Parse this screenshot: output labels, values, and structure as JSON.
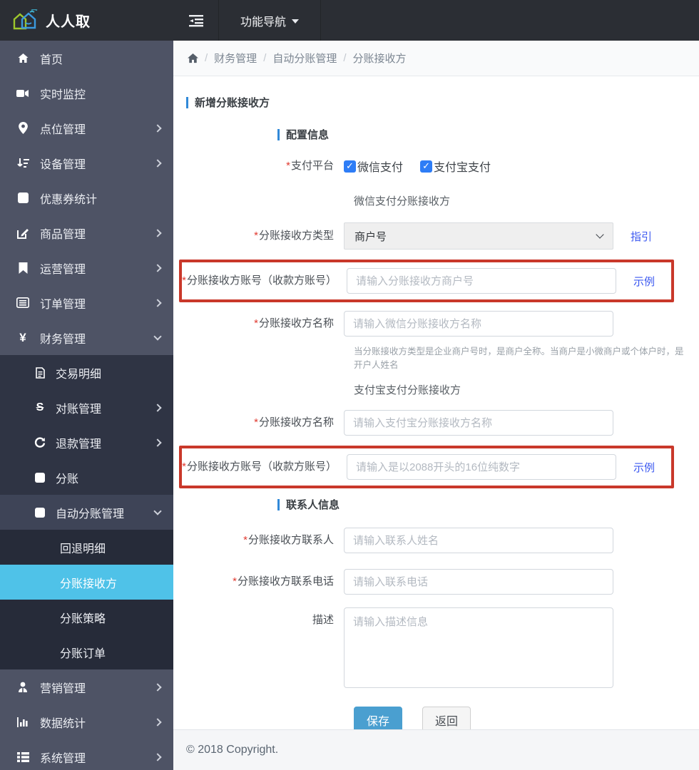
{
  "colors": {
    "c-header": "#2b2e34",
    "c-sidebar": "#4e5365",
    "c-sub1": "#2f3444",
    "c-sub1-open": "#3e4457",
    "c-sub2": "#262b39",
    "c-active": "#4fc2e8",
    "c-bar": "#3189d8",
    "c-link": "#3a57f0",
    "c-hl": "#c9382a",
    "c-primary": "#4a9fd0",
    "c-checkbox": "#2e7df6"
  },
  "header": {
    "brand": "人人取",
    "nav_label": "功能导航"
  },
  "breadcrumb": {
    "items": [
      "财务管理",
      "自动分账管理",
      "分账接收方"
    ],
    "sep": "/"
  },
  "sidebar": {
    "items": [
      {
        "label": "首页"
      },
      {
        "label": "实时监控"
      },
      {
        "label": "点位管理"
      },
      {
        "label": "设备管理"
      },
      {
        "label": "优惠券统计"
      },
      {
        "label": "商品管理"
      },
      {
        "label": "运营管理"
      },
      {
        "label": "订单管理"
      },
      {
        "label": "财务管理"
      },
      {
        "label": "交易明细"
      },
      {
        "label": "对账管理"
      },
      {
        "label": "退款管理"
      },
      {
        "label": "分账"
      },
      {
        "label": "自动分账管理"
      },
      {
        "label": "回退明细"
      },
      {
        "label": "分账接收方"
      },
      {
        "label": "分账策略"
      },
      {
        "label": "分账订单"
      },
      {
        "label": "营销管理"
      },
      {
        "label": "数据统计"
      },
      {
        "label": "系统管理"
      }
    ],
    "yen_glyph": "¥",
    "recon_glyph": "S"
  },
  "form": {
    "title": "新增分账接收方",
    "required_mark": "*",
    "check_glyph": "✓",
    "section_config": "配置信息",
    "section_contact": "联系人信息",
    "pay_platform": {
      "label": "支付平台",
      "options": [
        {
          "label": "微信支付",
          "checked": true
        },
        {
          "label": "支付宝支付",
          "checked": true
        }
      ]
    },
    "wechat": {
      "subtitle": "微信支付分账接收方",
      "type_label": "分账接收方类型",
      "type_value": "商户号",
      "type_link": "指引",
      "account_label": "分账接收方账号（收款方账号）",
      "account_placeholder": "请输入分账接收方商户号",
      "account_link": "示例",
      "name_label": "分账接收方名称",
      "name_placeholder": "请输入微信分账接收方名称",
      "hint": "当分账接收方类型是企业商户号时，是商户全称。当商户是小微商户或个体户时，是开户人姓名"
    },
    "alipay": {
      "subtitle": "支付宝支付分账接收方",
      "name_label": "分账接收方名称",
      "name_placeholder": "请输入支付宝分账接收方名称",
      "account_label": "分账接收方账号（收款方账号）",
      "account_placeholder": "请输入是以2088开头的16位纯数字",
      "account_link": "示例"
    },
    "contact": {
      "person_label": "分账接收方联系人",
      "person_placeholder": "请输入联系人姓名",
      "phone_label": "分账接收方联系电话",
      "phone_placeholder": "请输入联系电话",
      "desc_label": "描述",
      "desc_placeholder": "请输入描述信息"
    },
    "buttons": {
      "save": "保存",
      "back": "返回"
    }
  },
  "footer": {
    "copyright": "© 2018 Copyright."
  }
}
